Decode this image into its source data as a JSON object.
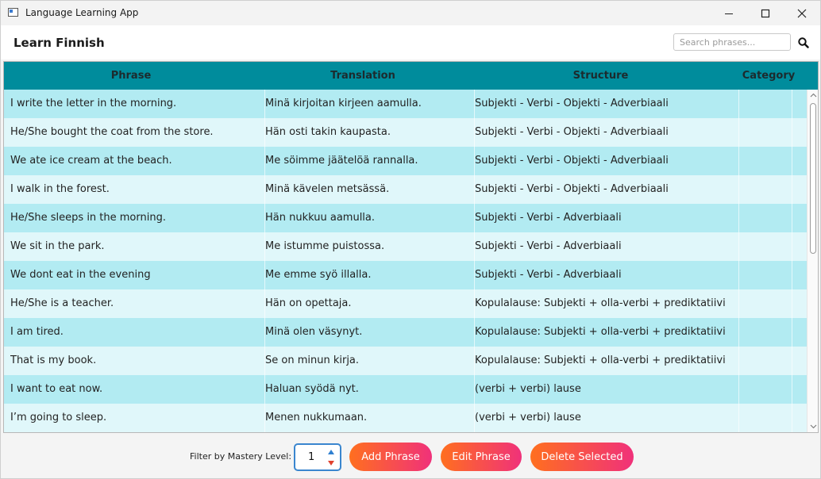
{
  "window": {
    "title": "Language Learning App"
  },
  "header": {
    "title": "Learn Finnish",
    "search_placeholder": "Search phrases..."
  },
  "table": {
    "columns": [
      "Phrase",
      "Translation",
      "Structure",
      "Category"
    ],
    "rows": [
      [
        "I write the letter in the morning.",
        "Minä kirjoitan kirjeen aamulla.",
        "Subjekti - Verbi - Objekti - Adverbiaali",
        ""
      ],
      [
        "He/She bought the coat from the store.",
        "Hän osti takin kaupasta.",
        "Subjekti - Verbi - Objekti - Adverbiaali",
        ""
      ],
      [
        "We ate ice cream at the beach.",
        "Me söimme jäätelöä rannalla.",
        "Subjekti - Verbi - Objekti - Adverbiaali",
        ""
      ],
      [
        "I walk in the forest.",
        "Minä kävelen metsässä.",
        "Subjekti - Verbi - Objekti - Adverbiaali",
        ""
      ],
      [
        "He/She sleeps in the morning.",
        "Hän nukkuu aamulla.",
        "Subjekti - Verbi - Adverbiaali",
        ""
      ],
      [
        "We sit in the park.",
        "Me istumme puistossa.",
        "Subjekti - Verbi - Adverbiaali",
        ""
      ],
      [
        "We dont eat in the evening",
        "Me emme syö illalla.",
        "Subjekti - Verbi - Adverbiaali",
        ""
      ],
      [
        "He/She is a teacher.",
        "Hän on opettaja.",
        "Kopulalause: Subjekti + olla-verbi + prediktatiivi",
        ""
      ],
      [
        "I am tired.",
        "Minä olen väsynyt.",
        "Kopulalause: Subjekti + olla-verbi + prediktatiivi",
        ""
      ],
      [
        "That is my book.",
        "Se on minun kirja.",
        "Kopulalause: Subjekti + olla-verbi + prediktatiivi",
        ""
      ],
      [
        "I want to eat now.",
        "Haluan syödä nyt.",
        "(verbi + verbi) lause",
        ""
      ],
      [
        "I’m going to sleep.",
        "Menen nukkumaan.",
        "(verbi + verbi) lause",
        ""
      ]
    ]
  },
  "footer": {
    "filter_label": "Filter by Mastery Level:",
    "mastery_level": "1",
    "add_label": "Add Phrase",
    "edit_label": "Edit Phrase",
    "delete_label": "Delete Selected"
  },
  "colors": {
    "header_bg": "#008c9c",
    "row_odd": "#b2ebf2",
    "row_even": "#e0f7fa",
    "button_gradient_start": "#ff6f1f",
    "button_gradient_end": "#f0317a",
    "spinner_border": "#3a86cf"
  },
  "icons": {
    "app": "app-window-icon",
    "minimize": "minimize-icon",
    "maximize": "maximize-icon",
    "close": "close-icon",
    "search": "search-icon",
    "scroll_up": "chevron-up-icon",
    "scroll_down": "chevron-down-icon"
  }
}
